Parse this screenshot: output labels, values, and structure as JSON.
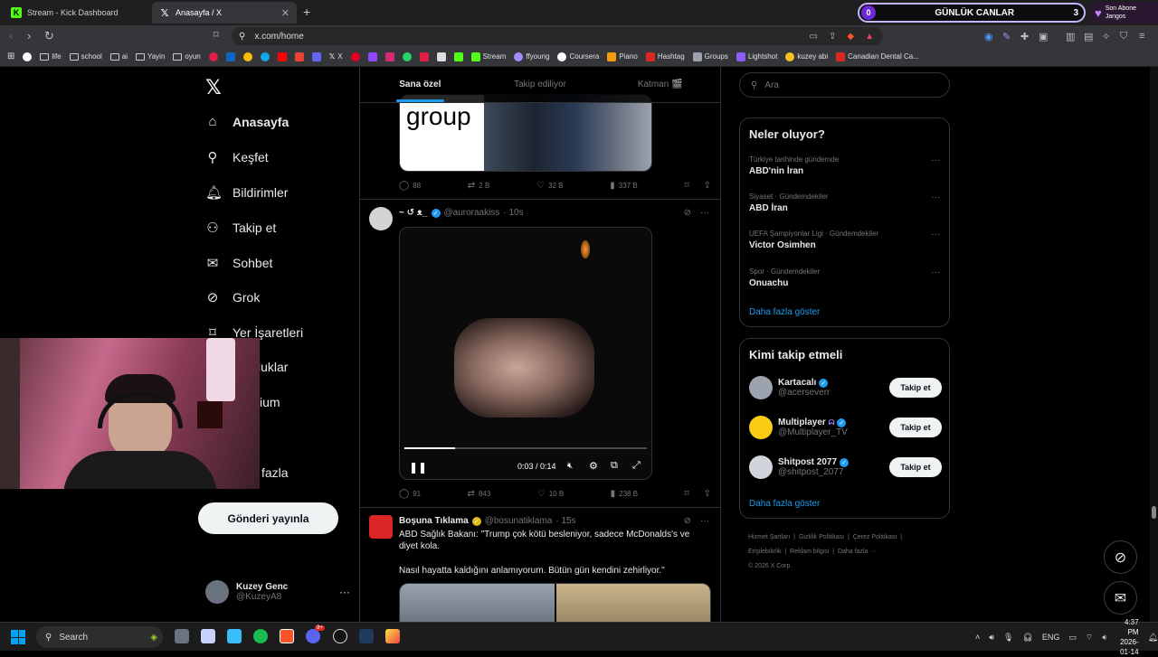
{
  "browser": {
    "tabs": [
      {
        "title": "Stream - Kick Dashboard",
        "active": false
      },
      {
        "title": "Anasayfa / X",
        "active": true
      }
    ],
    "url": "x.com/home",
    "overlay": {
      "left_num": "0",
      "title": "GÜNLÜK CANLAR",
      "right_num": "3"
    },
    "subscriber": {
      "line1": "Son Abone",
      "line2": "Jangos"
    },
    "bookmarks": [
      "life",
      "school",
      "ai",
      "Yayin",
      "oyun",
      "X",
      "Stream",
      "ffyoung",
      "Coursera",
      "Piano",
      "Hashtag",
      "Groups",
      "Lightshot",
      "kuzey abi",
      "Canadian Dental Ca..."
    ]
  },
  "nav": {
    "items": [
      "Anasayfa",
      "Keşfet",
      "Bildirimler",
      "Takip et",
      "Sohbet",
      "Grok",
      "Yer İşaretleri",
      "luklar",
      "ium",
      "fazla"
    ],
    "icons": [
      "home-icon",
      "search-icon",
      "bell-icon",
      "add-user-icon",
      "mail-icon",
      "grok-icon",
      "bookmark-icon",
      "communities-icon",
      "premium-icon",
      "more-icon"
    ],
    "post_button": "Gönderi yayınla",
    "profile": {
      "name": "Kuzey Genc",
      "handle": "@KuzeyA8"
    }
  },
  "feed": {
    "tabs": [
      "Sana özel",
      "Takip ediliyor",
      "Katman 🎬"
    ],
    "tweet1": {
      "media_text": "group",
      "replies": "88",
      "retweets": "2 B",
      "likes": "32 B",
      "views": "337 B"
    },
    "tweet2": {
      "name": "~ ↺ ᴥ_",
      "handle": "@auroraakiss",
      "time": "· 10s",
      "video_time": "0:03 / 0:14",
      "video_progress": 0.21,
      "replies": "91",
      "retweets": "843",
      "likes": "10 B",
      "views": "238 B"
    },
    "tweet3": {
      "name": "Boşuna Tıklama",
      "handle": "@bosunatiklama",
      "time": "· 15s",
      "text1": "ABD Sağlık Bakanı: \"Trump çok kötü besleniyor, sadece McDonalds's ve diyet kola.",
      "text2": "Nasıl hayatta kaldığını anlamıyorum. Bütün gün kendini zehirliyor.\""
    }
  },
  "sidebar": {
    "search_placeholder": "Ara",
    "trends_title": "Neler oluyor?",
    "trends": [
      {
        "meta": "Türkiye tarihinde gündemde",
        "title": "ABD'nin İran"
      },
      {
        "meta": "Siyaset · Gündemdekiler",
        "title": "ABD İran"
      },
      {
        "meta": "UEFA Şampiyonlar Ligi · Gündemdekiler",
        "title": "Victor Osimhen"
      },
      {
        "meta": "Spor · Gündemdekiler",
        "title": "Onuachu"
      }
    ],
    "show_more": "Daha fazla göster",
    "who_title": "Kimi takip etmeli",
    "who": [
      {
        "name": "Kartacalı",
        "handle": "@acerseverr",
        "button": "Takip et"
      },
      {
        "name": "Multiplayer",
        "handle": "@Multiplayer_TV",
        "button": "Takip et"
      },
      {
        "name": "Shitpost 2077",
        "handle": "@shitpost_2077",
        "button": "Takip et"
      }
    ],
    "footer": [
      "Hizmet Şartları",
      "Gizlilik Politikası",
      "Çerez Politikası",
      "Erişilebilirlik",
      "Reklam bilgisi",
      "Daha fazla ···",
      "© 2026 X Corp."
    ]
  },
  "taskbar": {
    "search": "Search",
    "lang": "ENG",
    "time": "4:37 PM",
    "date": "2026-01-14",
    "discord_badge": "9+"
  },
  "colors": {
    "accent": "#1d9bf0",
    "kick": "#53fc18",
    "brave": "#fb542b"
  }
}
